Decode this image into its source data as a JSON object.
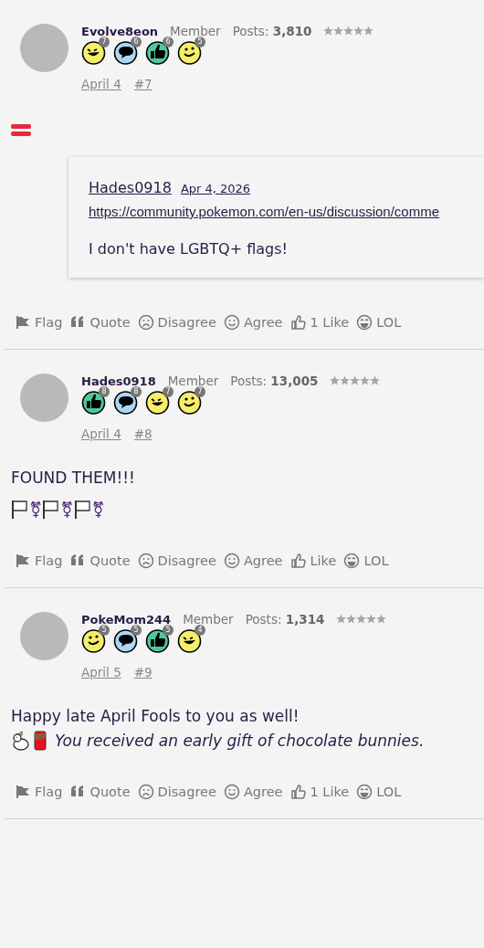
{
  "posts": [
    {
      "author": "Evolve8eon",
      "role": "Member",
      "posts_label": "Posts:",
      "posts_count": "3,810",
      "badges": [
        {
          "kind": "wink",
          "count": "7"
        },
        {
          "kind": "chat",
          "count": "6"
        },
        {
          "kind": "thumb",
          "count": "6"
        },
        {
          "kind": "smile",
          "count": "5"
        }
      ],
      "date": "April 4",
      "number": "#7",
      "body": [
        {
          "kind": "flag-emoji"
        },
        {
          "kind": "quote",
          "author": "Hades0918",
          "date": "Apr 4, 2026",
          "link": "https://community.pokemon.com/en-us/discussion/comme",
          "text": "I don't have LGBTQ+ flags!"
        }
      ],
      "actions": [
        {
          "kind": "flag",
          "label": "Flag"
        },
        {
          "kind": "quote",
          "label": "Quote"
        },
        {
          "kind": "disagree",
          "label": "Disagree"
        },
        {
          "kind": "agree",
          "label": "Agree"
        },
        {
          "kind": "like",
          "label": "1 Like"
        },
        {
          "kind": "lol",
          "label": "LOL"
        }
      ]
    },
    {
      "author": "Hades0918",
      "role": "Member",
      "posts_label": "Posts:",
      "posts_count": "13,005",
      "badges": [
        {
          "kind": "thumb",
          "count": "8"
        },
        {
          "kind": "chat",
          "count": "8"
        },
        {
          "kind": "wink",
          "count": "7"
        },
        {
          "kind": "smile",
          "count": "7"
        }
      ],
      "date": "April 4",
      "number": "#8",
      "body": [
        {
          "kind": "text",
          "text": "FOUND THEM!!!"
        },
        {
          "kind": "symbols",
          "items": [
            {
              "kind": "white-flag"
            },
            {
              "kind": "char",
              "text": "⚧"
            },
            {
              "kind": "white-flag"
            },
            {
              "kind": "char",
              "text": "⚧"
            },
            {
              "kind": "white-flag"
            },
            {
              "kind": "char",
              "text": "⚧"
            }
          ]
        }
      ],
      "actions": [
        {
          "kind": "flag",
          "label": "Flag"
        },
        {
          "kind": "quote",
          "label": "Quote"
        },
        {
          "kind": "disagree",
          "label": "Disagree"
        },
        {
          "kind": "agree",
          "label": "Agree"
        },
        {
          "kind": "like",
          "label": "Like"
        },
        {
          "kind": "lol",
          "label": "LOL"
        }
      ]
    },
    {
      "author": "PokeMom244",
      "role": "Member",
      "posts_label": "Posts:",
      "posts_count": "1,314",
      "badges": [
        {
          "kind": "smile",
          "count": "5"
        },
        {
          "kind": "chat",
          "count": "5"
        },
        {
          "kind": "thumb",
          "count": "5"
        },
        {
          "kind": "wink",
          "count": "4"
        }
      ],
      "date": "April 5",
      "number": "#9",
      "body": [
        {
          "kind": "text",
          "text": "Happy late April Fools to you as well!"
        },
        {
          "kind": "gift",
          "text": "You received an early gift of chocolate bunnies."
        }
      ],
      "actions": [
        {
          "kind": "flag",
          "label": "Flag"
        },
        {
          "kind": "quote",
          "label": "Quote"
        },
        {
          "kind": "disagree",
          "label": "Disagree"
        },
        {
          "kind": "agree",
          "label": "Agree"
        },
        {
          "kind": "like",
          "label": "1 Like"
        },
        {
          "kind": "lol",
          "label": "LOL"
        }
      ]
    }
  ]
}
